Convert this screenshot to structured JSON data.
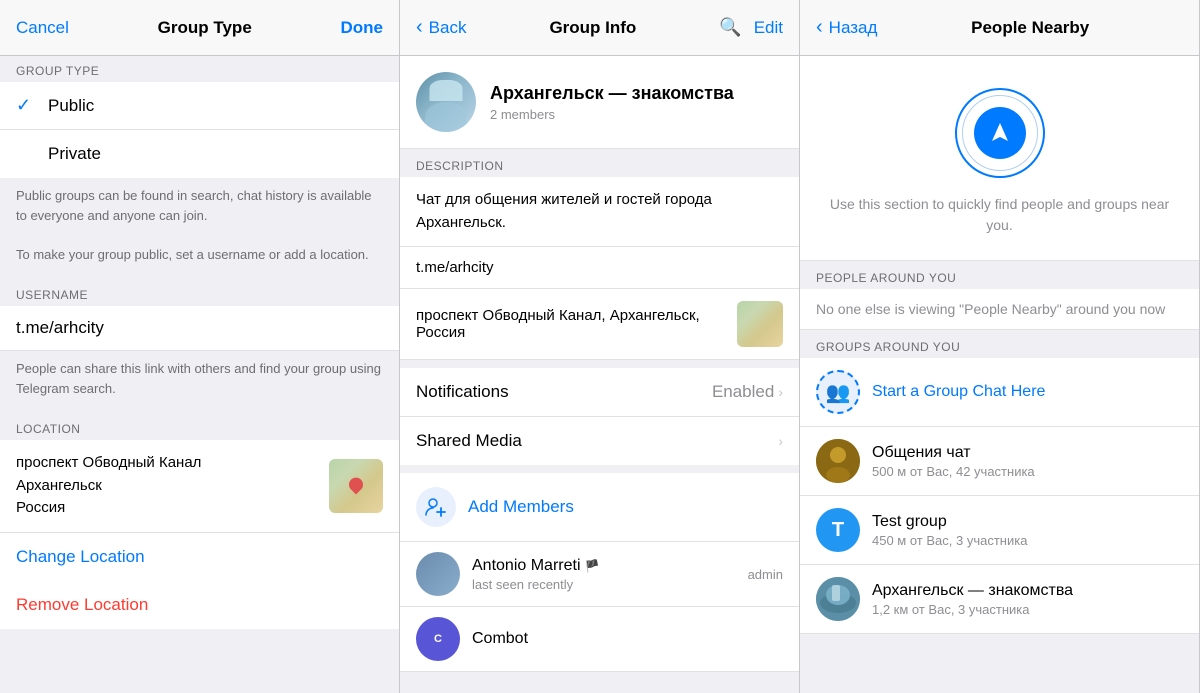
{
  "panel1": {
    "nav": {
      "cancel": "Cancel",
      "title": "Group Type",
      "done": "Done"
    },
    "section_group_type": "GROUP TYPE",
    "options": [
      {
        "label": "Public",
        "checked": true
      },
      {
        "label": "Private",
        "checked": false
      }
    ],
    "info1": "Public groups can be found in search, chat history is available to everyone and anyone can join.",
    "info2": "To make your group public, set a username or add a location.",
    "section_username": "USERNAME",
    "username_value": "t.me/arhcity",
    "username_info": "People can share this link with others and find your group using Telegram search.",
    "section_location": "LOCATION",
    "location_line1": "проспект Обводный Канал",
    "location_line2": "Архангельск",
    "location_line3": "Россия",
    "change_location": "Change Location",
    "remove_location": "Remove Location"
  },
  "panel2": {
    "nav": {
      "back": "Back",
      "title": "Group Info",
      "search_icon": "search",
      "edit": "Edit"
    },
    "group": {
      "name": "Архангельск — знакомства",
      "members": "2 members"
    },
    "section_description": "DESCRIPTION",
    "description_text": "Чат для общения жителей и гостей города Архангельск.",
    "description_link": "t.me/arhcity",
    "description_location": "проспект Обводный Канал, Архангельск, Россия",
    "notifications": {
      "label": "Notifications",
      "value": "Enabled"
    },
    "shared_media": {
      "label": "Shared Media"
    },
    "add_members": "Add Members",
    "members": [
      {
        "name": "Antonio Marreti",
        "status": "last seen recently",
        "role": "admin",
        "flag": "🏴",
        "type": "antonio"
      },
      {
        "name": "Combot",
        "status": "",
        "role": "",
        "type": "combot"
      }
    ]
  },
  "panel3": {
    "nav": {
      "back": "Назад",
      "title": "People Nearby"
    },
    "location_desc": "Use this section to quickly find people and groups near you.",
    "section_people": "PEOPLE AROUND YOU",
    "people_empty": "No one else is viewing \"People Nearby\" around you now",
    "section_groups": "GROUPS AROUND YOU",
    "groups": [
      {
        "name": "Start a Group Chat Here",
        "distance": "",
        "type": "start",
        "icon": "👥"
      },
      {
        "name": "Общения чат",
        "distance": "500 м от Вас, 42 участника",
        "type": "obshenya"
      },
      {
        "name": "Test group",
        "distance": "450 м от Вас, 3 участника",
        "type": "test",
        "initial": "T"
      },
      {
        "name": "Архангельск — знакомства",
        "distance": "1,2 км от Вас, 3 участника",
        "type": "arkhangelsk"
      }
    ]
  }
}
